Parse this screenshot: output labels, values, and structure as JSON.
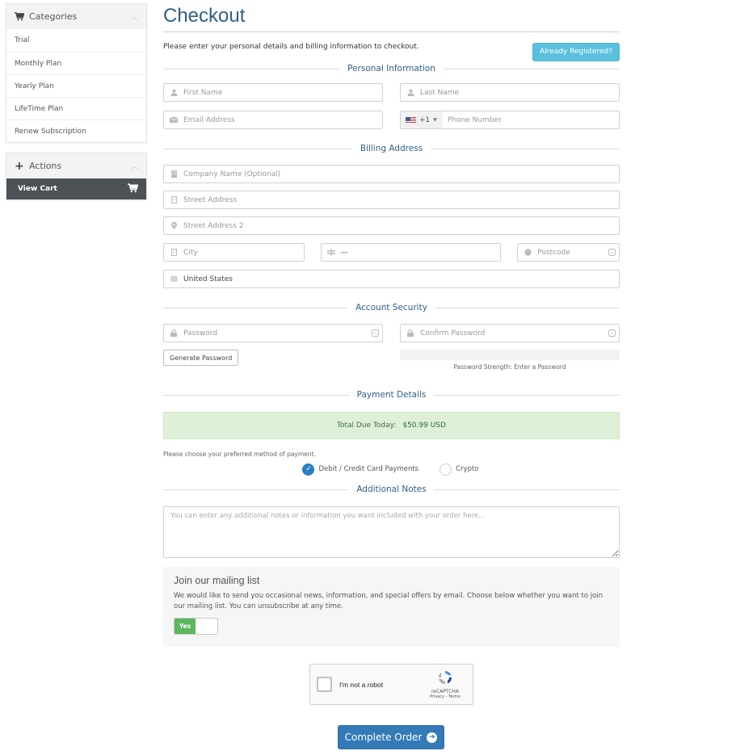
{
  "sidebar": {
    "categories": {
      "title": "Categories",
      "icon": "cart-icon",
      "items": [
        {
          "label": "Trial"
        },
        {
          "label": "Monthly Plan"
        },
        {
          "label": "Yearly Plan"
        },
        {
          "label": "LifeTime Plan"
        },
        {
          "label": "Renew Subscription"
        }
      ]
    },
    "actions": {
      "title": "Actions",
      "icon": "plus-icon",
      "items": [
        {
          "label": "View Cart",
          "icon": "cart-icon"
        }
      ]
    }
  },
  "header": {
    "title": "Checkout",
    "intro": "Please enter your personal details and billing information to checkout.",
    "already_registered": "Already Registered?"
  },
  "sections": {
    "personal": "Personal Information",
    "billing": "Billing Address",
    "security": "Account Security",
    "payment": "Payment Details",
    "notes": "Additional Notes"
  },
  "personal": {
    "first_name": {
      "placeholder": "First Name",
      "icon": "user-icon"
    },
    "last_name": {
      "placeholder": "Last Name",
      "icon": "user-icon"
    },
    "email": {
      "placeholder": "Email Address",
      "icon": "envelope-icon"
    },
    "phone": {
      "country_code": "+1",
      "country_flag": "us-flag",
      "placeholder": "Phone Number"
    }
  },
  "billing": {
    "company": {
      "placeholder": "Company Name (Optional)",
      "icon": "building-icon"
    },
    "street": {
      "placeholder": "Street Address",
      "icon": "building-outline-icon"
    },
    "street2": {
      "placeholder": "Street Address 2",
      "icon": "map-marker-icon"
    },
    "city": {
      "placeholder": "City",
      "icon": "building-outline-icon"
    },
    "state": {
      "value": "—",
      "icon": "signpost-icon"
    },
    "postcode": {
      "placeholder": "Postcode",
      "icon": "certificate-icon"
    },
    "country": {
      "value": "United States",
      "icon": "globe-icon"
    }
  },
  "security": {
    "password": {
      "placeholder": "Password",
      "icon": "lock-icon"
    },
    "confirm": {
      "placeholder": "Confirm Password",
      "icon": "lock-icon"
    },
    "generate": "Generate Password",
    "strength_text": "Password Strength: Enter a Password",
    "strength_percent": 0
  },
  "payment": {
    "total_label": "Total Due Today:",
    "total_amount": "$50.99 USD",
    "hint": "Please choose your preferred method of payment.",
    "methods": [
      {
        "label": "Debit / Credit Card Payments",
        "selected": true
      },
      {
        "label": "Crypto",
        "selected": false
      }
    ]
  },
  "notes": {
    "placeholder": "You can enter any additional notes or information you want included with your order here..."
  },
  "mailing": {
    "title": "Join our mailing list",
    "body": "We would like to send you occasional news, information, and special offers by email. Choose below whether you want to join our mailing list. You can unsubscribe at any time.",
    "toggle_label": "Yes",
    "toggle_on": true
  },
  "captcha": {
    "label": "I'm not a robot",
    "brand": "reCAPTCHA",
    "links": "Privacy - Terms"
  },
  "submit": {
    "label": "Complete Order",
    "icon": "arrow-circle-right-icon"
  },
  "colors": {
    "title": "#2f5f8a",
    "info": "#5bc0de",
    "primary": "#337ab7",
    "success_bg": "#dff0d8",
    "toggle_on": "#5cb85c",
    "sidebar_active": "#4b5155"
  }
}
